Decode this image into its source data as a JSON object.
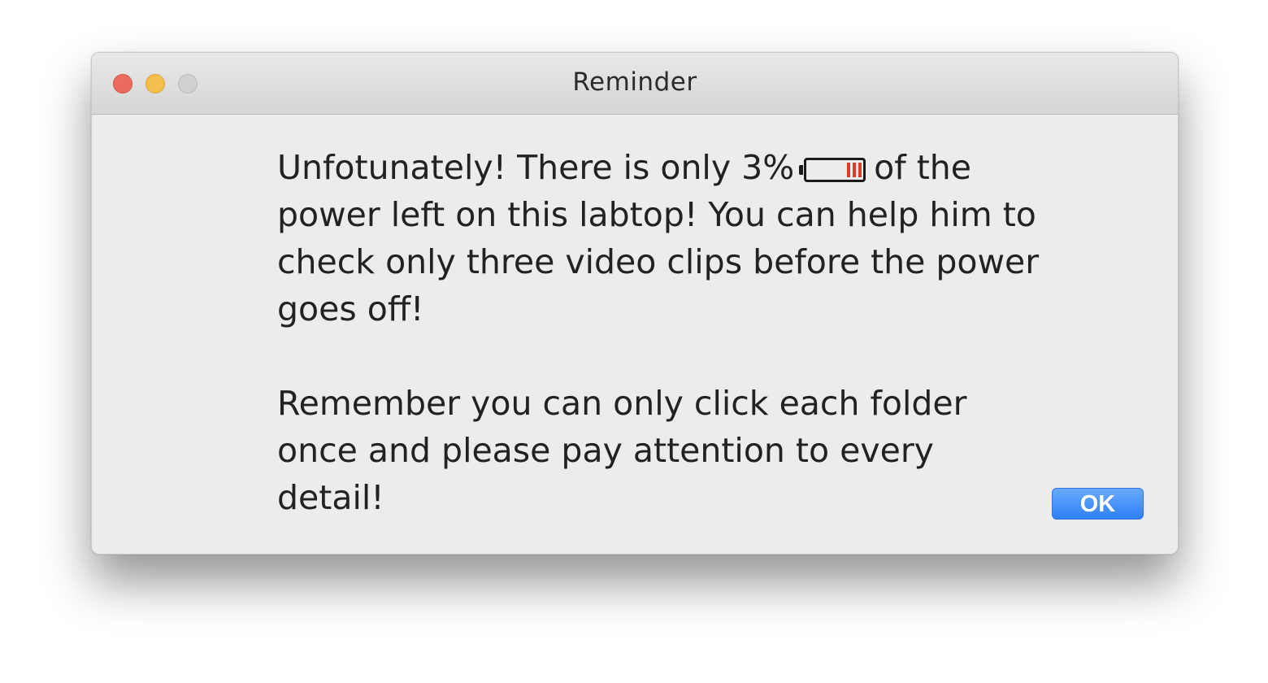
{
  "window": {
    "title": "Reminder"
  },
  "message": {
    "paragraph1_before": "Unfotunately! There is only 3%",
    "paragraph1_after": "of the power left on this labtop! You can help him to check only three video clips before the power goes off!",
    "paragraph2": "Remember you can only click each folder once and please pay attention to every detail!"
  },
  "battery": {
    "level_percent": 3,
    "icon": "battery-low-icon",
    "cell_color": "#e23a2a"
  },
  "buttons": {
    "ok_label": "OK"
  },
  "colors": {
    "accent": "#2f80f4",
    "close": "#ed6a5e",
    "minimize": "#f5bf4f",
    "zoom": "#d0d0d0"
  }
}
